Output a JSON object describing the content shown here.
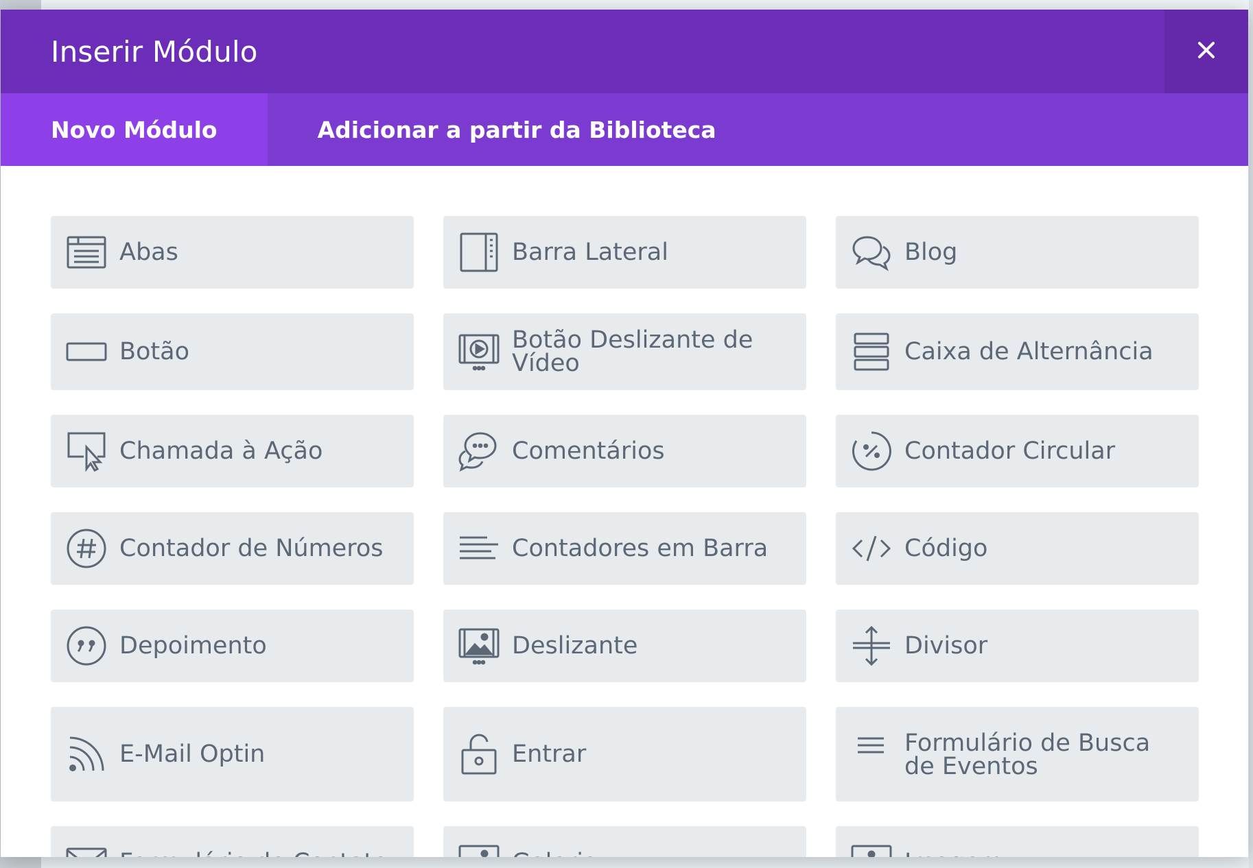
{
  "modal": {
    "title": "Inserir Módulo",
    "close_icon": "close-icon"
  },
  "tabs": [
    {
      "label": "Novo Módulo",
      "active": true
    },
    {
      "label": "Adicionar a partir da Biblioteca",
      "active": false
    }
  ],
  "modules": [
    {
      "label": "Abas",
      "icon": "tabs-icon"
    },
    {
      "label": "Barra Lateral",
      "icon": "sidebar-icon"
    },
    {
      "label": "Blog",
      "icon": "blog-icon"
    },
    {
      "label": "Botão",
      "icon": "button-icon"
    },
    {
      "label": "Botão Deslizante de Vídeo",
      "icon": "video-slider-icon"
    },
    {
      "label": "Caixa de Alternância",
      "icon": "toggle-icon"
    },
    {
      "label": "Chamada à Ação",
      "icon": "call-to-action-icon"
    },
    {
      "label": "Comentários",
      "icon": "comments-icon"
    },
    {
      "label": "Contador Circular",
      "icon": "circle-counter-icon"
    },
    {
      "label": "Contador de Números",
      "icon": "number-counter-icon"
    },
    {
      "label": "Contadores em Barra",
      "icon": "bar-counters-icon"
    },
    {
      "label": "Código",
      "icon": "code-icon"
    },
    {
      "label": "Depoimento",
      "icon": "testimonial-icon"
    },
    {
      "label": "Deslizante",
      "icon": "slider-icon"
    },
    {
      "label": "Divisor",
      "icon": "divider-icon"
    },
    {
      "label": "E-Mail Optin",
      "icon": "email-optin-icon"
    },
    {
      "label": "Entrar",
      "icon": "login-icon"
    },
    {
      "label": "Formulário de Busca de Eventos",
      "icon": "event-search-icon"
    },
    {
      "label": "Formulário de Contato",
      "icon": "contact-form-icon"
    },
    {
      "label": "Galeria",
      "icon": "gallery-icon"
    },
    {
      "label": "Imagem",
      "icon": "image-icon"
    }
  ],
  "colors": {
    "header": "#6c2eb9",
    "tabs_bar": "#7c3bd0",
    "active_tab": "#8e40e8",
    "module_bg": "#e8ebee",
    "module_text": "#5d6876"
  }
}
